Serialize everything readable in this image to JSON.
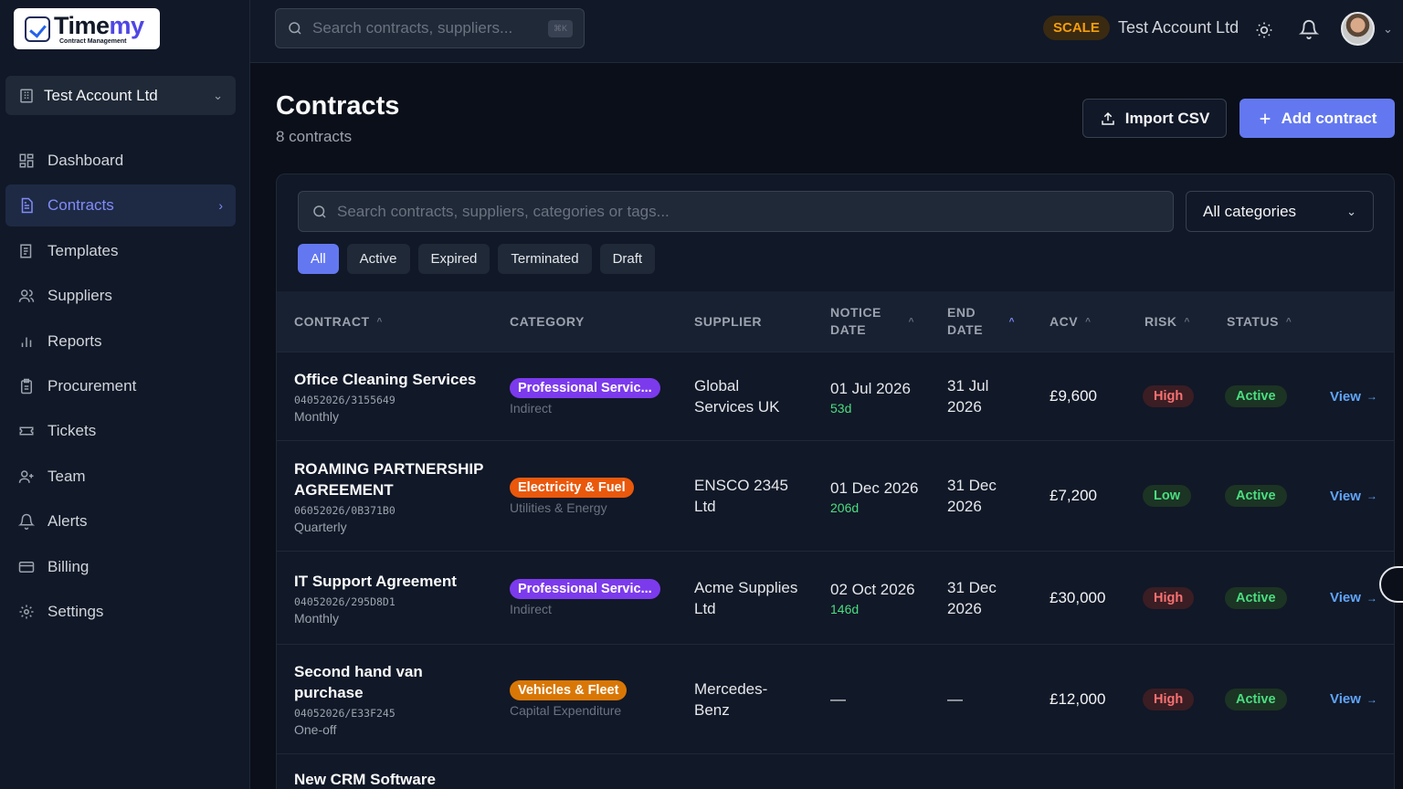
{
  "logo": {
    "word_a": "Time",
    "word_b": "my",
    "sub": "Contract Management"
  },
  "account_switch": {
    "label": "Test Account Ltd"
  },
  "nav": [
    {
      "label": "Dashboard",
      "icon": "dashboard-icon"
    },
    {
      "label": "Contracts",
      "icon": "document-icon",
      "active": true
    },
    {
      "label": "Templates",
      "icon": "template-icon"
    },
    {
      "label": "Suppliers",
      "icon": "users-icon"
    },
    {
      "label": "Reports",
      "icon": "bar-chart-icon"
    },
    {
      "label": "Procurement",
      "icon": "clipboard-icon"
    },
    {
      "label": "Tickets",
      "icon": "ticket-icon"
    },
    {
      "label": "Team",
      "icon": "user-plus-icon"
    },
    {
      "label": "Alerts",
      "icon": "bell-icon"
    },
    {
      "label": "Billing",
      "icon": "credit-card-icon"
    },
    {
      "label": "Settings",
      "icon": "gear-icon"
    }
  ],
  "topbar": {
    "search_placeholder": "Search contracts, suppliers...",
    "shortcut": "⌘K",
    "plan": "SCALE",
    "account": "Test Account Ltd"
  },
  "page": {
    "title": "Contracts",
    "count": "8 contracts",
    "import_label": "Import CSV",
    "add_label": "Add contract"
  },
  "panel": {
    "search_placeholder": "Search contracts, suppliers, categories or tags...",
    "category_select": "All categories",
    "filters": [
      "All",
      "Active",
      "Expired",
      "Terminated",
      "Draft"
    ],
    "active_filter": "All"
  },
  "table": {
    "headers": {
      "contract": "CONTRACT",
      "category": "CATEGORY",
      "supplier": "SUPPLIER",
      "notice_1": "NOTICE",
      "notice_2": "DATE",
      "end_1": "END",
      "end_2": "DATE",
      "acv": "ACV",
      "risk": "RISK",
      "status": "STATUS"
    },
    "view_label": "View",
    "rows": [
      {
        "title": "Office Cleaning Services",
        "code": "04052026/3155649",
        "frequency": "Monthly",
        "category": "Professional Servic...",
        "category_color": "#7c3aed",
        "category_sub": "Indirect",
        "supplier": "Global Services UK",
        "notice": "01 Jul 2026",
        "notice_days": "53d",
        "end": "31 Jul 2026",
        "acv": "£9,600",
        "risk": "High",
        "status": "Active"
      },
      {
        "title": "ROAMING PARTNERSHIP AGREEMENT",
        "code": "06052026/0B371B0",
        "frequency": "Quarterly",
        "category": "Electricity & Fuel",
        "category_color": "#ea580c",
        "category_sub": "Utilities & Energy",
        "supplier": "ENSCO 2345 Ltd",
        "notice": "01 Dec 2026",
        "notice_days": "206d",
        "end": "31 Dec 2026",
        "acv": "£7,200",
        "risk": "Low",
        "status": "Active"
      },
      {
        "title": "IT Support Agreement",
        "code": "04052026/295D8D1",
        "frequency": "Monthly",
        "category": "Professional Servic...",
        "category_color": "#7c3aed",
        "category_sub": "Indirect",
        "supplier": "Acme Supplies Ltd",
        "notice": "02 Oct 2026",
        "notice_days": "146d",
        "end": "31 Dec 2026",
        "acv": "£30,000",
        "risk": "High",
        "status": "Active"
      },
      {
        "title": "Second hand van purchase",
        "code": "04052026/E33F245",
        "frequency": "One-off",
        "category": "Vehicles & Fleet",
        "category_color": "#d97706",
        "category_sub": "Capital Expenditure",
        "supplier": "Mercedes-Benz",
        "notice": "—",
        "notice_days": "",
        "end": "—",
        "acv": "£12,000",
        "risk": "High",
        "status": "Active"
      },
      {
        "title": "New CRM Software",
        "code": "",
        "frequency": "",
        "category": "",
        "category_color": "",
        "category_sub": "",
        "supplier": "",
        "notice": "",
        "notice_days": "",
        "end": "",
        "acv": "",
        "risk": "",
        "status": ""
      }
    ]
  }
}
